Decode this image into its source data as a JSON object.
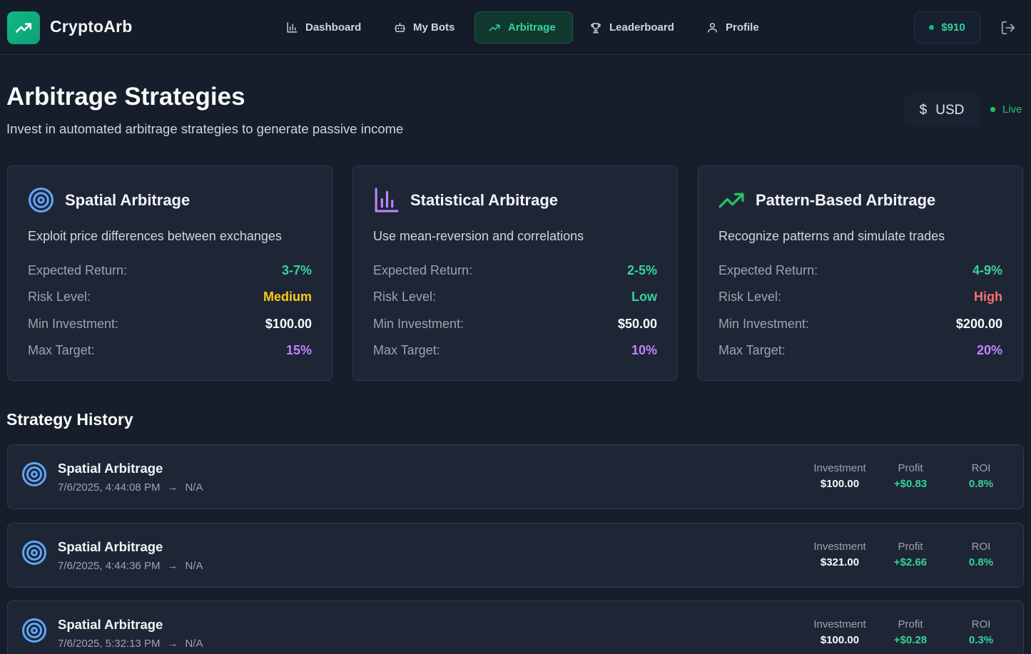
{
  "app": {
    "name": "CryptoArb"
  },
  "nav": {
    "items": [
      {
        "label": "Dashboard",
        "icon": "bar-chart-icon"
      },
      {
        "label": "My Bots",
        "icon": "bot-icon"
      },
      {
        "label": "Arbitrage",
        "icon": "trending-up-icon",
        "active": true
      },
      {
        "label": "Leaderboard",
        "icon": "trophy-icon"
      },
      {
        "label": "Profile",
        "icon": "user-icon"
      }
    ],
    "balance": "$910"
  },
  "header": {
    "title": "Arbitrage Strategies",
    "subtitle": "Invest in automated arbitrage strategies to generate passive income",
    "currency": "USD",
    "currency_symbol": "$",
    "status": "Live"
  },
  "strategies": [
    {
      "title": "Spatial Arbitrage",
      "icon": "target-icon",
      "description": "Exploit price differences between exchanges",
      "stats": {
        "expected_return_label": "Expected Return:",
        "expected_return": "3-7%",
        "risk_label": "Risk Level:",
        "risk": "Medium",
        "min_investment_label": "Min Investment:",
        "min_investment": "$100.00",
        "max_target_label": "Max Target:",
        "max_target": "15%"
      }
    },
    {
      "title": "Statistical Arbitrage",
      "icon": "bar-chart-icon",
      "description": "Use mean-reversion and correlations",
      "stats": {
        "expected_return_label": "Expected Return:",
        "expected_return": "2-5%",
        "risk_label": "Risk Level:",
        "risk": "Low",
        "min_investment_label": "Min Investment:",
        "min_investment": "$50.00",
        "max_target_label": "Max Target:",
        "max_target": "10%"
      }
    },
    {
      "title": "Pattern-Based Arbitrage",
      "icon": "trending-up-icon",
      "description": "Recognize patterns and simulate trades",
      "stats": {
        "expected_return_label": "Expected Return:",
        "expected_return": "4-9%",
        "risk_label": "Risk Level:",
        "risk": "High",
        "min_investment_label": "Min Investment:",
        "min_investment": "$200.00",
        "max_target_label": "Max Target:",
        "max_target": "20%"
      }
    }
  ],
  "history": {
    "title": "Strategy History",
    "labels": {
      "investment": "Investment",
      "profit": "Profit",
      "roi": "ROI"
    },
    "rows": [
      {
        "name": "Spatial Arbitrage",
        "start": "7/6/2025, 4:44:08 PM",
        "arrow": "→",
        "end": "N/A",
        "investment": "$100.00",
        "profit": "+$0.83",
        "roi": "0.8%"
      },
      {
        "name": "Spatial Arbitrage",
        "start": "7/6/2025, 4:44:36 PM",
        "arrow": "→",
        "end": "N/A",
        "investment": "$321.00",
        "profit": "+$2.66",
        "roi": "0.8%"
      },
      {
        "name": "Spatial Arbitrage",
        "start": "7/6/2025, 5:32:13 PM",
        "arrow": "→",
        "end": "N/A",
        "investment": "$100.00",
        "profit": "+$0.28",
        "roi": "0.3%"
      }
    ]
  },
  "colors": {
    "accent": "#10b981",
    "positive": "#34d399",
    "medium": "#facc15",
    "high": "#f87171",
    "target": "#c084fc"
  }
}
